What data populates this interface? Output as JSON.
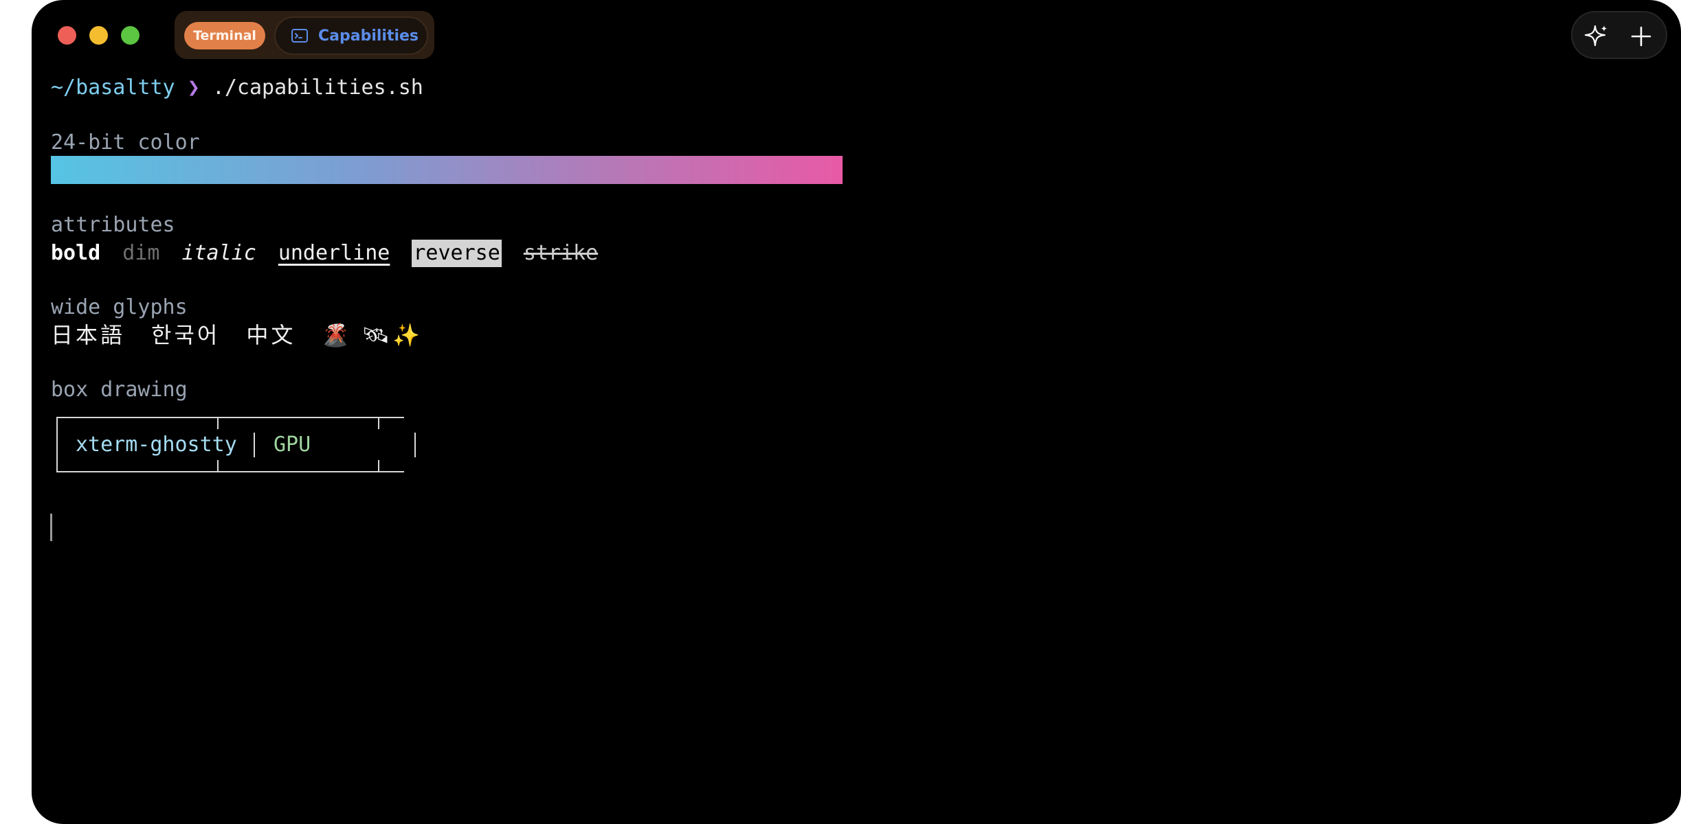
{
  "titlebar": {
    "tabs": [
      {
        "label": "Terminal",
        "style": "pill",
        "color": "#e2804a"
      },
      {
        "label": "Capabilities",
        "icon": "terminal-icon",
        "selected": true,
        "color": "#5b8dea"
      }
    ],
    "controls": [
      {
        "icon": "sparkle-icon"
      },
      {
        "icon": "plus-icon"
      }
    ]
  },
  "terminal": {
    "prompt": {
      "dir": "~/basaltty",
      "arrow": "❯",
      "command": "./capabilities.sh"
    },
    "color_section": {
      "label": "24-bit color",
      "gradient": [
        "#56c4e4",
        "#e85aa6"
      ]
    },
    "attributes_section": {
      "label": "attributes",
      "items": {
        "bold": "bold",
        "dim": "dim",
        "italic": "italic",
        "underline": "underline",
        "reverse": "reverse",
        "strike": "strike"
      }
    },
    "wide_section": {
      "label": "wide glyphs",
      "japanese": "日本語",
      "korean": "한국어",
      "chinese": "中文",
      "emoji": "🌋 🛰✨"
    },
    "box_section": {
      "label": "box drawing",
      "cell1": "xterm-ghostty",
      "separator": "│",
      "cell2": "GPU"
    }
  }
}
